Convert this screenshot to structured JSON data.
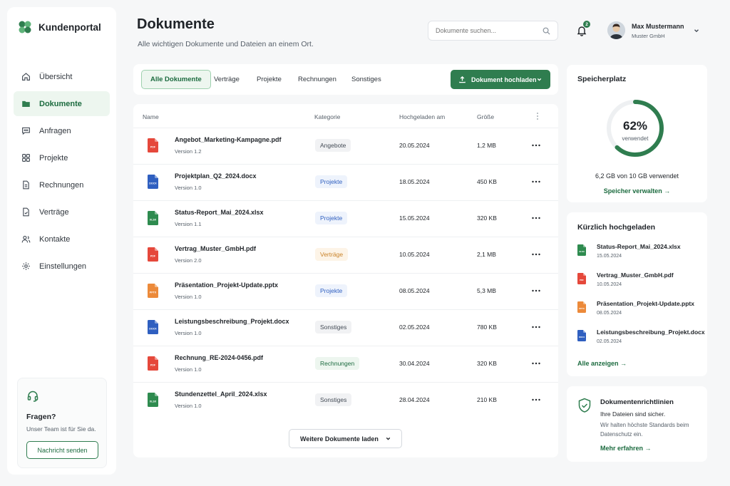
{
  "app": {
    "name": "Kundenportal"
  },
  "sidebar": {
    "items": [
      {
        "label": "Übersicht",
        "icon": "home-icon"
      },
      {
        "label": "Dokumente",
        "icon": "folder-icon",
        "active": true
      },
      {
        "label": "Anfragen",
        "icon": "chat-icon"
      },
      {
        "label": "Projekte",
        "icon": "grid-icon"
      },
      {
        "label": "Rechnungen",
        "icon": "invoice-icon"
      },
      {
        "label": "Verträge",
        "icon": "contract-icon"
      },
      {
        "label": "Kontakte",
        "icon": "contacts-icon"
      },
      {
        "label": "Einstellungen",
        "icon": "gear-icon"
      }
    ],
    "help": {
      "title": "Fragen?",
      "text": "Unser Team ist für Sie da.",
      "button": "Nachricht senden"
    }
  },
  "header": {
    "title": "Dokumente",
    "subtitle": "Alle wichtigen Dokumente und Dateien an einem Ort.",
    "search_placeholder": "Dokumente suchen...",
    "notifications": "2",
    "user": {
      "name": "Max Mustermann",
      "company": "Muster GmbH"
    }
  },
  "toolbar": {
    "tabs": [
      "Alle Dokumente",
      "Verträge",
      "Projekte",
      "Rechnungen",
      "Sonstiges"
    ],
    "upload_label": "Dokument hochladen"
  },
  "table": {
    "columns": {
      "name": "Name",
      "category": "Kategorie",
      "uploaded": "Hochgeladen am",
      "size": "Größe"
    },
    "rows": [
      {
        "name": "Angebot_Marketing-Kampagne.pdf",
        "version": "Version 1.2",
        "category": "Angebote",
        "date": "20.05.2024",
        "size": "1,2 MB",
        "type": "pdf"
      },
      {
        "name": "Projektplan_Q2_2024.docx",
        "version": "Version 1.0",
        "category": "Projekte",
        "date": "18.05.2024",
        "size": "450 KB",
        "type": "docx"
      },
      {
        "name": "Status-Report_Mai_2024.xlsx",
        "version": "Version 1.1",
        "category": "Projekte",
        "date": "15.05.2024",
        "size": "320 KB",
        "type": "xlsx"
      },
      {
        "name": "Vertrag_Muster_GmbH.pdf",
        "version": "Version 2.0",
        "category": "Verträge",
        "date": "10.05.2024",
        "size": "2,1 MB",
        "type": "pdf"
      },
      {
        "name": "Präsentation_Projekt-Update.pptx",
        "version": "Version 1.0",
        "category": "Projekte",
        "date": "08.05.2024",
        "size": "5,3 MB",
        "type": "pptx"
      },
      {
        "name": "Leistungsbeschreibung_Projekt.docx",
        "version": "Version 1.0",
        "category": "Sonstiges",
        "date": "02.05.2024",
        "size": "780 KB",
        "type": "docx"
      },
      {
        "name": "Rechnung_RE-2024-0456.pdf",
        "version": "Version 1.0",
        "category": "Rechnungen",
        "date": "30.04.2024",
        "size": "320 KB",
        "type": "pdf"
      },
      {
        "name": "Stundenzettel_April_2024.xlsx",
        "version": "Version 1.0",
        "category": "Sonstiges",
        "date": "28.04.2024",
        "size": "210 KB",
        "type": "xlsx"
      }
    ],
    "load_more": "Weitere Dokumente laden"
  },
  "storage": {
    "title": "Speicherplatz",
    "percent_label": "62%",
    "percent_value": 62,
    "used_label": "verwendet",
    "detail": "6,2 GB von 10 GB verwendet",
    "link": "Speicher verwalten →"
  },
  "recent": {
    "title": "Kürzlich hochgeladen",
    "items": [
      {
        "name": "Status-Report_Mai_2024.xlsx",
        "date": "15.05.2024",
        "type": "xlsx"
      },
      {
        "name": "Vertrag_Muster_GmbH.pdf",
        "date": "10.05.2024",
        "type": "pdf"
      },
      {
        "name": "Präsentation_Projekt-Update.pptx",
        "date": "08.05.2024",
        "type": "pptx"
      },
      {
        "name": "Leistungsbeschreibung_Projekt.docx",
        "date": "02.05.2024",
        "type": "docx"
      }
    ],
    "link": "Alle anzeigen →"
  },
  "policy": {
    "title": "Dokumentenrichtlinien",
    "line1": "Ihre Dateien sind sicher.",
    "line2": "Wir halten höchste Standards beim Datenschutz ein.",
    "link": "Mehr erfahren →"
  },
  "colors": {
    "accent": "#2f7d4f",
    "accent_dark": "#1c6b3f",
    "pdf": "#e5483b",
    "docx": "#2f5fc0",
    "xlsx": "#2e8b4f",
    "pptx": "#ec8a3a"
  },
  "file_labels": {
    "pdf": "PDF",
    "docx": "DOCX",
    "xlsx": "XLSX",
    "pptx": "PPTX"
  }
}
